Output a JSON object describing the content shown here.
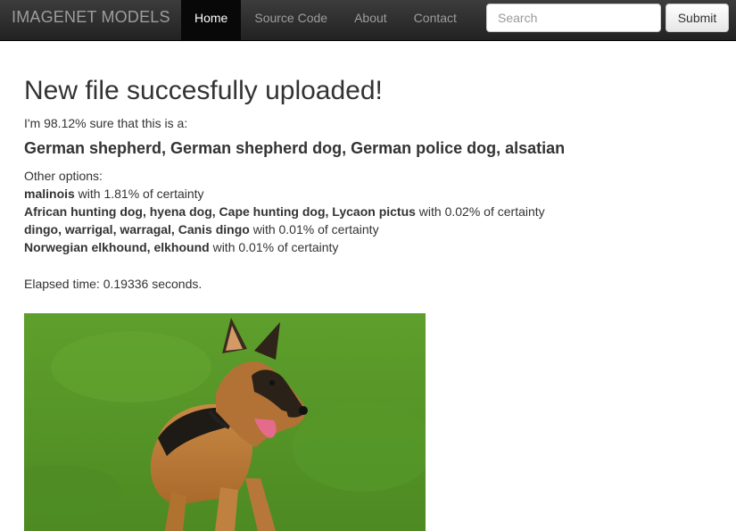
{
  "navbar": {
    "brand": "IMAGENET MODELS",
    "links": [
      {
        "label": "Home",
        "active": true
      },
      {
        "label": "Source Code"
      },
      {
        "label": "About"
      },
      {
        "label": "Contact"
      }
    ],
    "search": {
      "placeholder": "Search",
      "value": ""
    },
    "submit_label": "Submit"
  },
  "result": {
    "heading": "New file succesfully uploaded!",
    "sure_text": "I'm 98.12% sure that this is a:",
    "top_label": "German shepherd, German shepherd dog, German police dog, alsatian",
    "other_heading": "Other options:",
    "others": [
      {
        "name": "malinois",
        "certainty": " with 1.81% of certainty"
      },
      {
        "name": "African hunting dog, hyena dog, Cape hunting dog, Lycaon pictus",
        "certainty": " with 0.02% of certainty"
      },
      {
        "name": "dingo, warrigal, warragal, Canis dingo",
        "certainty": " with 0.01% of certainty"
      },
      {
        "name": "Norwegian elkhound, elkhound",
        "certainty": " with 0.01% of certainty"
      }
    ],
    "elapsed": "Elapsed time: 0.19336 seconds."
  },
  "colors": {
    "navbar_bg": "#222222",
    "grass": "#5a9a2a"
  }
}
